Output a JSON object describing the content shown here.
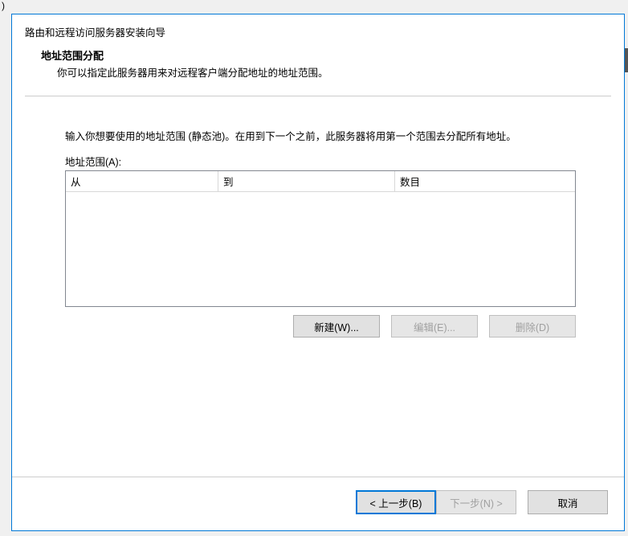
{
  "parent_fragment": ")",
  "dialog": {
    "title": "路由和远程访问服务器安装向导",
    "heading": "地址范围分配",
    "subheading": "你可以指定此服务器用来对远程客户端分配地址的地址范围。"
  },
  "content": {
    "instruction": "输入你想要使用的地址范围 (静态池)。在用到下一个之前，此服务器将用第一个范围去分配所有地址。",
    "range_label": "地址范围(A):",
    "columns": {
      "from": "从",
      "to": "到",
      "count": "数目"
    },
    "rows": []
  },
  "actions": {
    "new": "新建(W)...",
    "edit": "编辑(E)...",
    "delete": "删除(D)"
  },
  "nav": {
    "back": "< 上一步(B)",
    "next": "下一步(N) >",
    "cancel": "取消"
  }
}
